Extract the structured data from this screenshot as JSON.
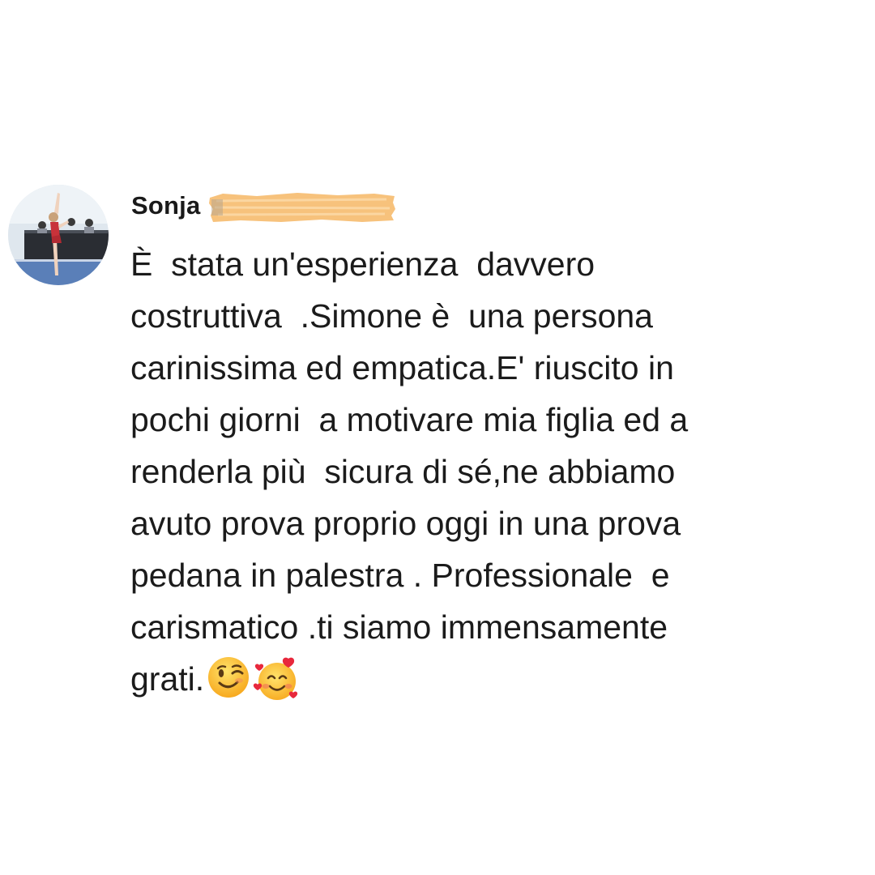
{
  "comment": {
    "author_first_name": "Sonja",
    "author_surname_redacted": true,
    "avatar_icon": "profile-photo-gymnast",
    "text": "È  stata un'esperienza  davvero\ncostruttiva  .Simone è  una persona\ncarinissima ed empatica.E' riuscito in\npochi giorni  a motivare mia figlia ed a\nrenderla più  sicura di sé,ne abbiamo\navuto prova proprio oggi in una prova\npedana in palestra . Professionale  e\ncarismatico .ti siamo immensamente\ngrati.",
    "emojis": [
      "winking-face-icon",
      "smiling-face-with-hearts-icon"
    ]
  },
  "colors": {
    "background": "#ffffff",
    "text": "#1b1b1b",
    "redaction": "#f7c27c"
  }
}
